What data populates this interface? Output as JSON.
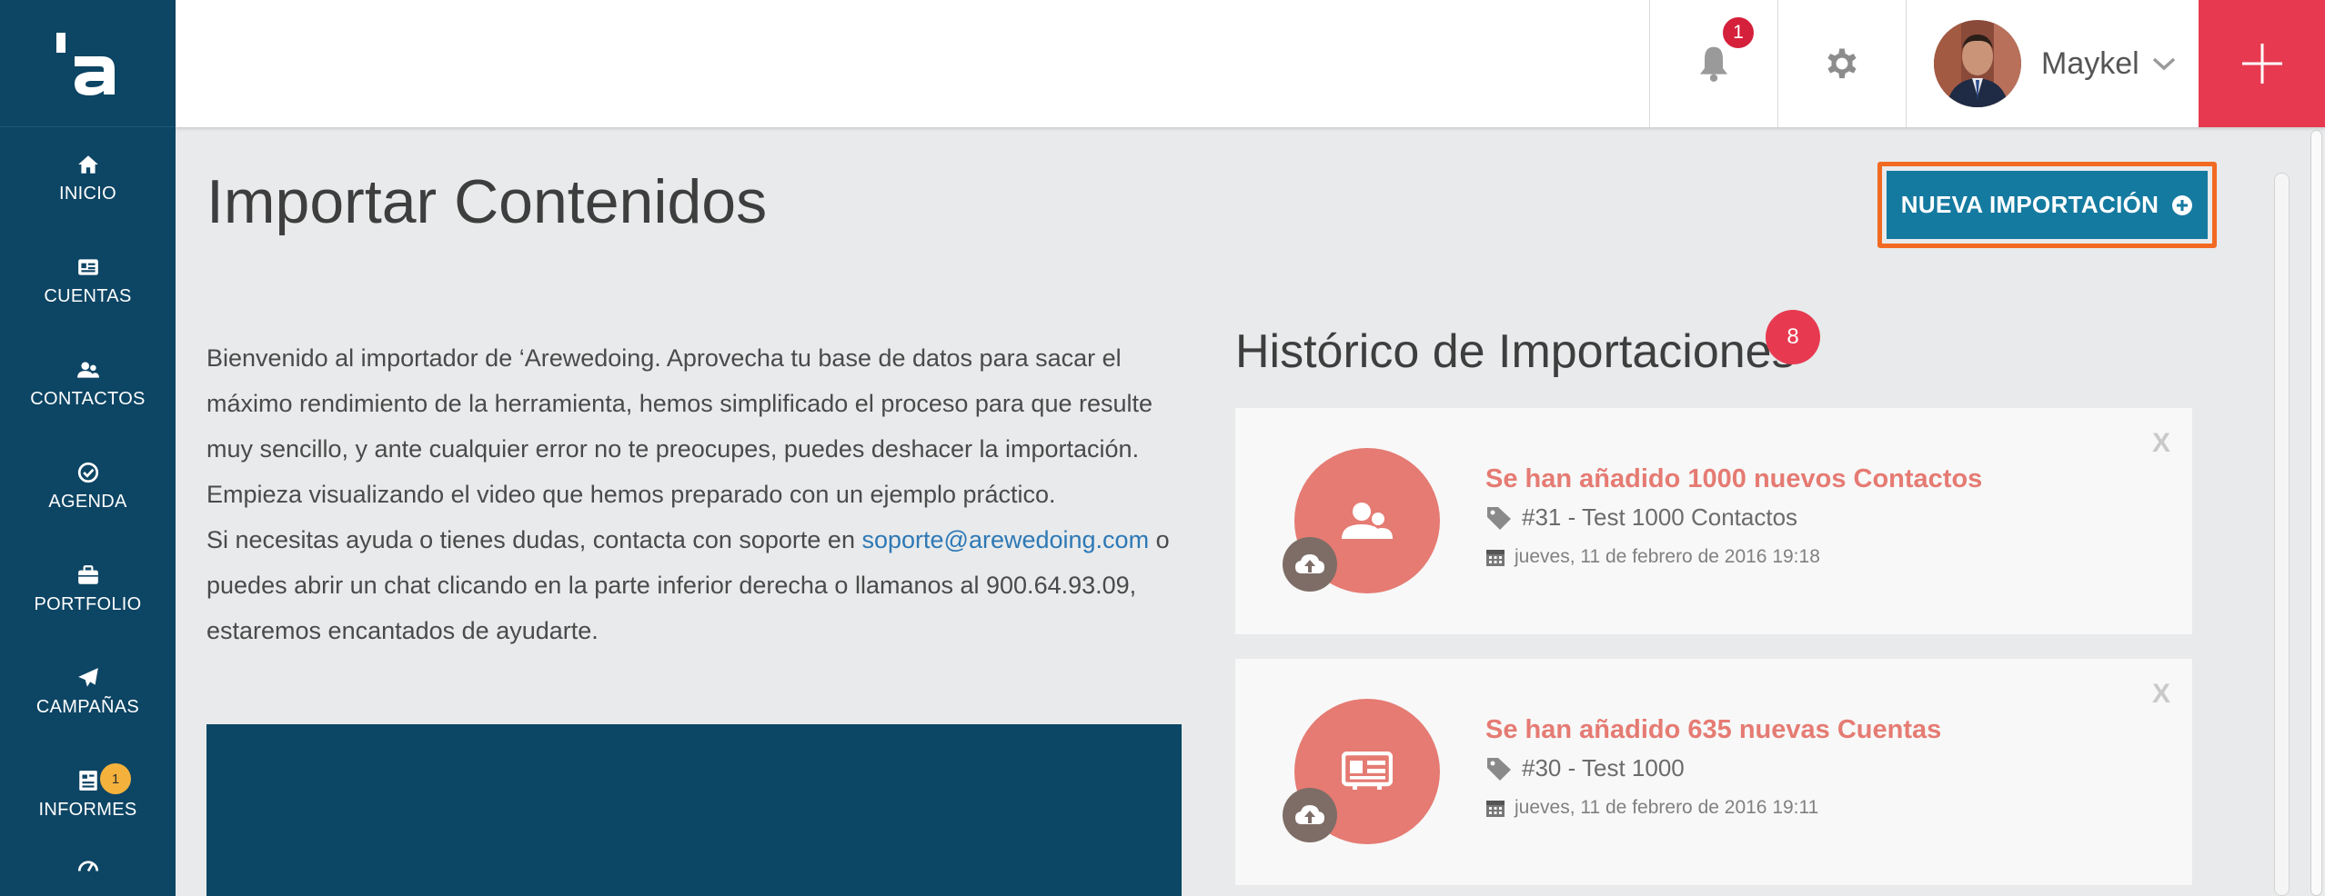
{
  "sidebar": {
    "items": [
      {
        "label": "INICIO",
        "icon": "home-icon"
      },
      {
        "label": "CUENTAS",
        "icon": "id-card-icon"
      },
      {
        "label": "CONTACTOS",
        "icon": "users-icon"
      },
      {
        "label": "AGENDA",
        "icon": "check-circle-icon"
      },
      {
        "label": "PORTFOLIO",
        "icon": "briefcase-icon"
      },
      {
        "label": "CAMPAÑAS",
        "icon": "paper-plane-icon"
      },
      {
        "label": "INFORMES",
        "icon": "report-icon",
        "badge": "1"
      }
    ]
  },
  "header": {
    "notifications_count": "1",
    "user_name": "Maykel"
  },
  "main": {
    "title": "Importar Contenidos",
    "new_import_label": "NUEVA IMPORTACIÓN",
    "intro": {
      "p1": "Bienvenido al importador de ‘Arewedoing. Aprovecha tu base de datos para sacar el máximo rendimiento de la herramienta, hemos simplificado el proceso para que resulte muy sencillo, y ante cualquier error no te preocupes, puedes deshacer la importación. Empieza visualizando el video que hemos preparado con un ejemplo práctico.",
      "p2_before": "Si necesitas ayuda o tienes dudas, contacta con soporte en ",
      "support_email": "soporte@arewedoing.com",
      "p2_after": " o puedes abrir un chat clicando en la parte inferior derecha o llamanos al 900.64.93.09, estaremos encantados de ayudarte."
    }
  },
  "history": {
    "title": "Histórico de Importaciones",
    "count": "8",
    "close_label": "X",
    "items": [
      {
        "title": "Se han añadido 1000 nuevos Contactos",
        "tag": "#31 - Test 1000 Contactos",
        "date": "jueves, 11 de febrero de 2016 19:18",
        "icon": "contacts-icon"
      },
      {
        "title": "Se han añadido 635 nuevas Cuentas",
        "tag": "#30 - Test 1000",
        "date": "jueves, 11 de febrero de 2016 19:11",
        "icon": "account-card-icon"
      }
    ]
  },
  "colors": {
    "sidebar_bg": "#0d4564",
    "accent_red": "#e73a50",
    "primary_button": "#157aa0",
    "highlight_outline": "#f26a21",
    "card_circle": "#e57b73"
  }
}
